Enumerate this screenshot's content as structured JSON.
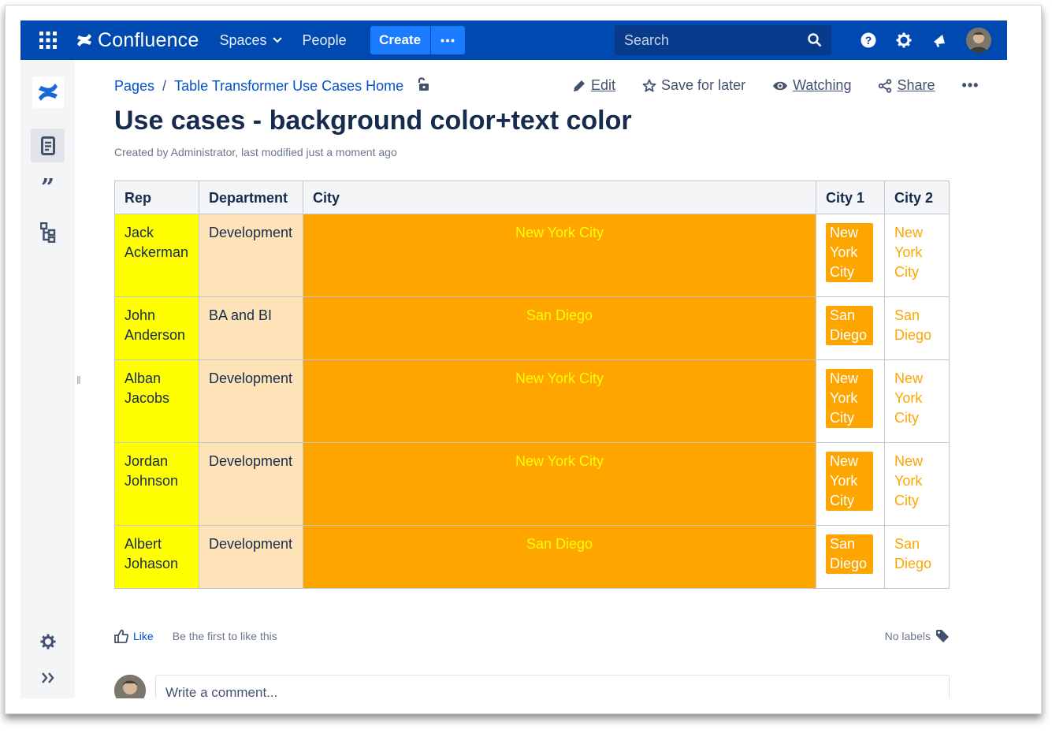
{
  "nav": {
    "logo_text": "Confluence",
    "spaces_label": "Spaces",
    "people_label": "People",
    "create_label": "Create",
    "search_placeholder": "Search",
    "brand_color": "#0049b0",
    "accent_color": "#1b7bff"
  },
  "rail": {
    "items": [
      "confluence-logo-icon",
      "pages-icon",
      "blog-quote-icon",
      "page-tree-icon",
      "settings-icon",
      "expand-icon"
    ]
  },
  "breadcrumb": {
    "root": "Pages",
    "separator": "/",
    "parent": "Table Transformer Use Cases Home"
  },
  "actions": {
    "edit": "Edit",
    "save_for_later": "Save for later",
    "watching": "Watching",
    "share": "Share",
    "more": "•••"
  },
  "page": {
    "title": "Use cases - background color+text color",
    "byline": "Created by Administrator, last modified just a moment ago"
  },
  "table": {
    "headers": [
      "Rep",
      "Department",
      "City",
      "City 1",
      "City 2"
    ],
    "rows": [
      {
        "rep": [
          "Jack",
          "Ackerman"
        ],
        "department": "Development",
        "city": "New York City",
        "city1": [
          "New",
          "York",
          "City"
        ],
        "city2": [
          "New",
          "York",
          "City"
        ]
      },
      {
        "rep": [
          "John",
          "Anderson"
        ],
        "department": "BA and BI",
        "city": "San Diego",
        "city1": [
          "San",
          "Diego"
        ],
        "city2": [
          "San",
          "Diego"
        ]
      },
      {
        "rep": [
          "Alban",
          "Jacobs"
        ],
        "department": "Development",
        "city": "New York City",
        "city1": [
          "New",
          "York",
          "City"
        ],
        "city2": [
          "New",
          "York",
          "City"
        ]
      },
      {
        "rep": [
          "Jordan",
          "Johnson"
        ],
        "department": "Development",
        "city": "New York City",
        "city1": [
          "New",
          "York",
          "City"
        ],
        "city2": [
          "New",
          "York",
          "City"
        ]
      },
      {
        "rep": [
          "Albert",
          "Johason"
        ],
        "department": "Development",
        "city": "San Diego",
        "city1": [
          "San",
          "Diego"
        ],
        "city2": [
          "San",
          "Diego"
        ]
      }
    ],
    "colors": {
      "rep_bg": "#ffff00",
      "department_bg": "#ffe3b8",
      "city_bg": "#ffa500",
      "city_text": "#ffff00",
      "city2_text": "#ffa500"
    }
  },
  "footer": {
    "like_label": "Like",
    "like_hint": "Be the first to like this",
    "labels_text": "No labels",
    "comment_placeholder": "Write a comment..."
  }
}
